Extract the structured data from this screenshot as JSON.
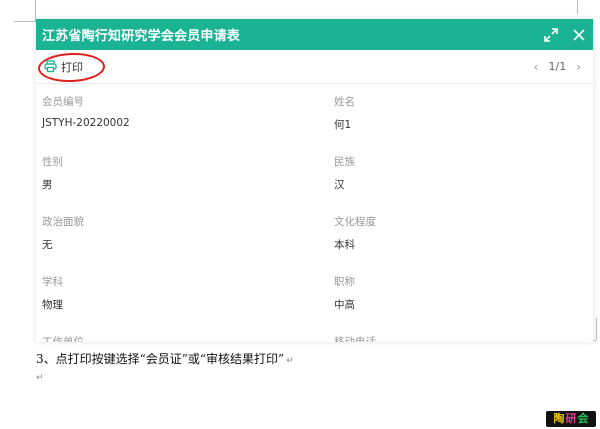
{
  "modal": {
    "title": "江苏省陶行知研究学会会员申请表",
    "header_color": "#1ab394",
    "icons": {
      "expand": "expand-icon",
      "close": "close-icon"
    }
  },
  "toolbar": {
    "print_label": "打印",
    "print_icon": "printer-icon",
    "pager": {
      "prev": "‹",
      "next": "›",
      "current": "1/1"
    }
  },
  "fields": [
    {
      "label": "会员编号",
      "value": "JSTYH-20220002"
    },
    {
      "label": "姓名",
      "value": "何1"
    },
    {
      "label": "性别",
      "value": "男"
    },
    {
      "label": "民族",
      "value": "汉"
    },
    {
      "label": "政治面貌",
      "value": "无"
    },
    {
      "label": "文化程度",
      "value": "本科"
    },
    {
      "label": "学科",
      "value": "物理"
    },
    {
      "label": "职称",
      "value": "中高"
    },
    {
      "label": "工作单位",
      "value": ""
    },
    {
      "label": "移动电话",
      "value": ""
    }
  ],
  "caption": {
    "text": "3、点打印按键选择“会员证”或“审核结果打印”",
    "para_mark": "↵"
  },
  "logo": {
    "char1": "陶",
    "char2": "研",
    "char3": "会"
  }
}
